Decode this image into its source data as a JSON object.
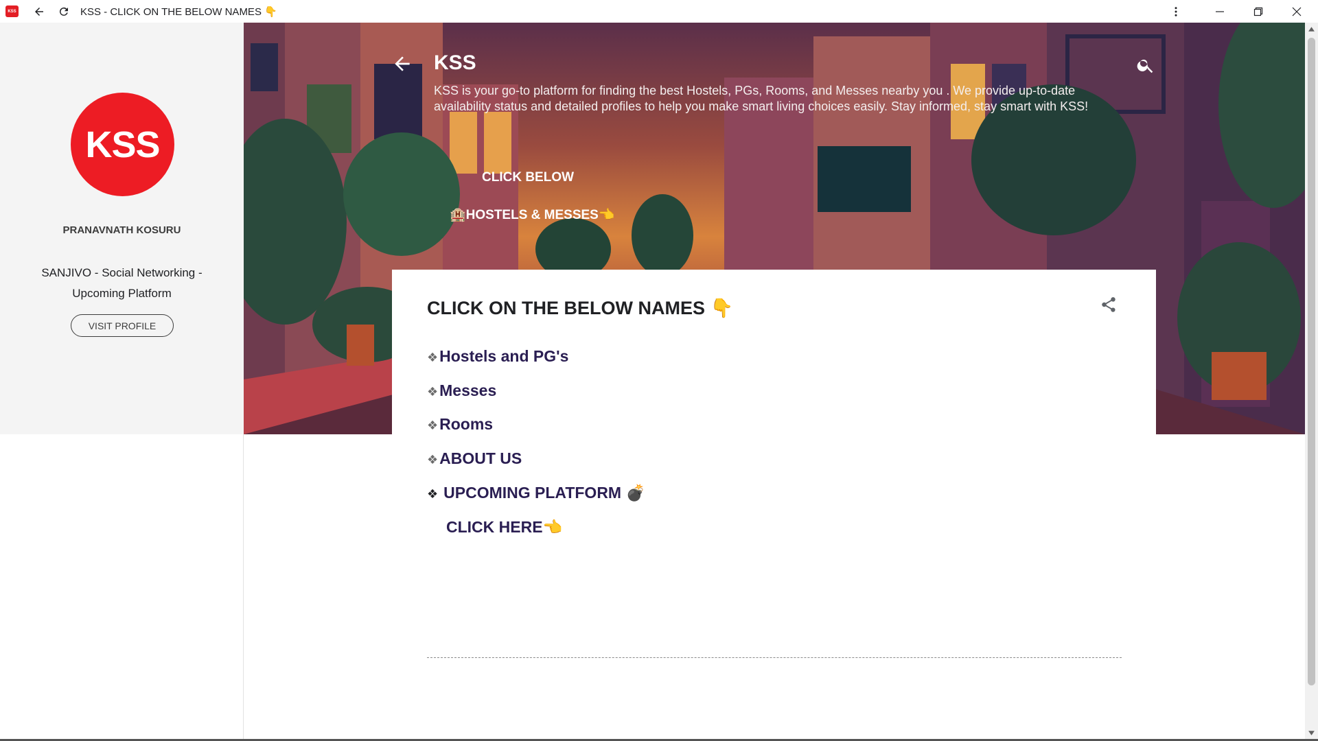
{
  "window": {
    "app_icon_text": "KSS",
    "title": "KSS - CLICK ON THE BELOW NAMES 👇"
  },
  "sidebar": {
    "logo_text": "KSS",
    "profile_name": "PRANAVNATH KOSURU",
    "profile_desc": "SANJIVO - Social Networking - Upcoming Platform",
    "visit_label": "VISIT PROFILE"
  },
  "hero": {
    "title": "KSS",
    "description": "KSS is your go-to platform for finding the best Hostels, PGs, Rooms, and Messes nearby you . We provide up-to-date availability status and detailed profiles to help you make smart living choices easily. Stay informed, stay smart with KSS!",
    "link_click_below": "CLICK BELOW",
    "link_hostels_messes": "🏨HOSTELS & MESSES👈"
  },
  "post": {
    "title": "CLICK ON THE BELOW NAMES 👇",
    "links": [
      {
        "bullet": "❖",
        "label": "Hostels and PG's"
      },
      {
        "bullet": "❖",
        "label": "Messes"
      },
      {
        "bullet": "❖",
        "label": "Rooms"
      },
      {
        "bullet": "❖",
        "label": "ABOUT US"
      },
      {
        "bullet": "❖",
        "label": "UPCOMING PLATFORM 💣"
      }
    ],
    "click_here": "CLICK HERE👈"
  },
  "colors": {
    "brand_red": "#ed1c24",
    "link_color": "#2a1e52",
    "dark_box": "#15323a"
  }
}
